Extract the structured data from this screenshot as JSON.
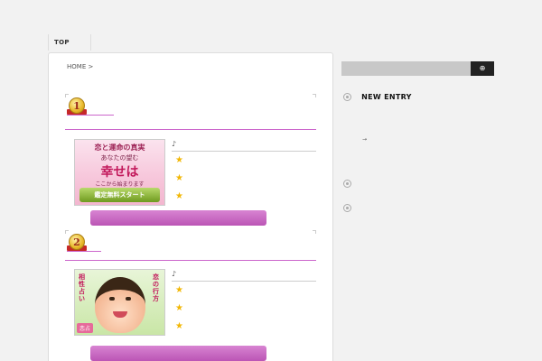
{
  "nav": {
    "top_label": "TOP"
  },
  "breadcrumb": {
    "home_label": "HOME",
    "separator": ">"
  },
  "rankings": [
    {
      "rank": "1",
      "banner": {
        "title": "恋と運命の真実",
        "subtitle": "あなたの望む",
        "headline": "幸せは",
        "tagline": "ここから始まります",
        "button": "鑑定無料スタート"
      },
      "note_icon": "♪",
      "stars": [
        "★",
        "★",
        "★"
      ]
    },
    {
      "rank": "2",
      "banner": {
        "vertical_left": "相性占い",
        "vertical_right": "恋の行方",
        "tag": "恋占"
      },
      "note_icon": "♪",
      "stars": [
        "★",
        "★",
        "★"
      ]
    }
  ],
  "sidebar": {
    "search_icon": "⊕",
    "new_entry_label": "NEW ENTRY",
    "arrow": "→"
  },
  "colors": {
    "accent": "#cc66cc",
    "button": "#c763c1",
    "star": "#f2b705"
  }
}
